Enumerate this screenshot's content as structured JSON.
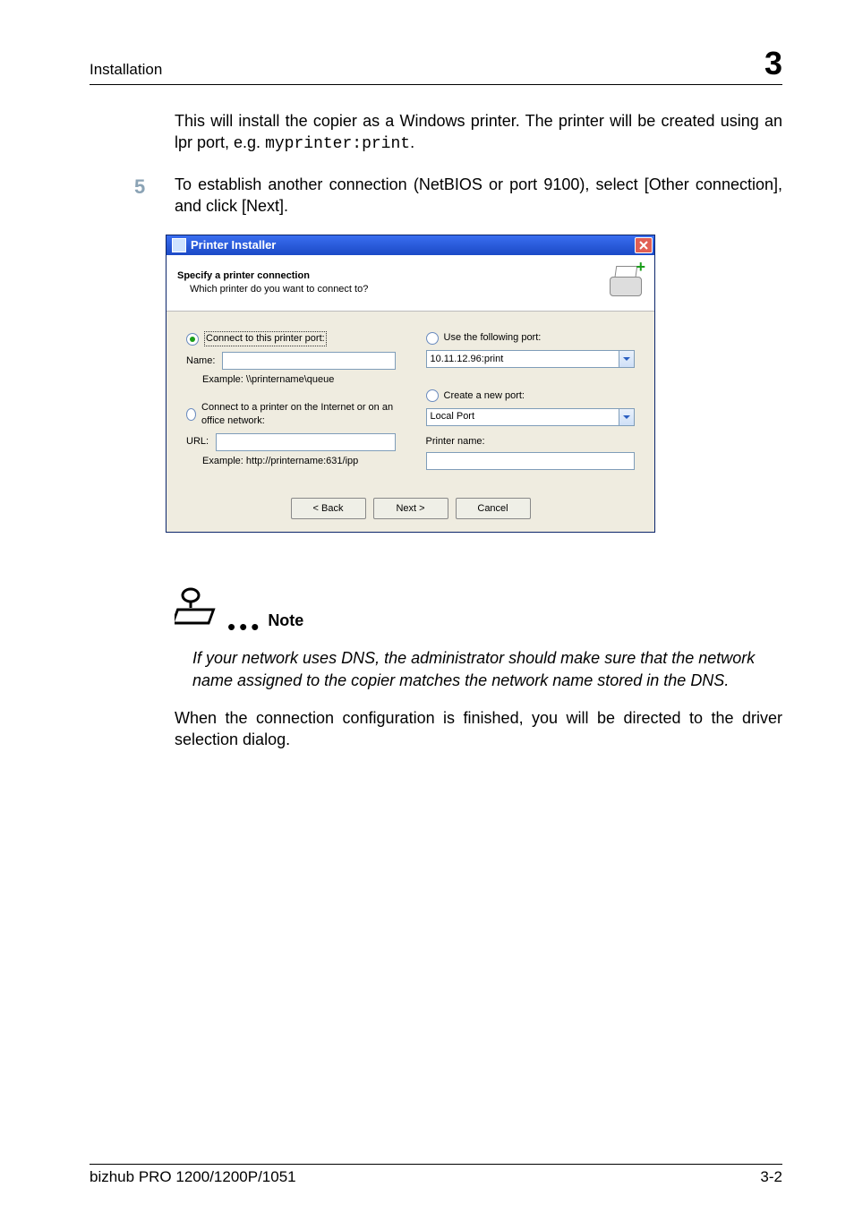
{
  "page": {
    "header_title": "Installation",
    "header_number": "3",
    "footer_left": "bizhub PRO 1200/1200P/1051",
    "footer_right": "3-2"
  },
  "body": {
    "para1_a": "This will install the copier as a Windows printer. The printer will be created using an lpr port, e.g. ",
    "para1_code": "myprinter:print",
    "para1_b": ".",
    "step_number": "5",
    "step_text": "To establish another connection (NetBIOS or port 9100), select [Other connection], and click [Next].",
    "note_label": "Note",
    "note_text": "If your network uses DNS, the administrator should make sure that the network name assigned to the copier matches the network name stored in the DNS.",
    "para2": "When the connection configuration is finished, you will be directed to the driver selection dialog."
  },
  "dialog": {
    "title": "Printer Installer",
    "header_title": "Specify a printer connection",
    "header_sub": "Which printer do you want to connect to?",
    "opt_connect_port": "Connect to this printer port:",
    "name_label": "Name:",
    "name_value": "",
    "name_example": "Example: \\\\printername\\queue",
    "opt_internet": "Connect to a printer on the Internet or on an office network:",
    "url_label": "URL:",
    "url_value": "",
    "url_example": "Example: http://printername:631/ipp",
    "opt_use_port": "Use the following port:",
    "use_port_value": "10.11.12.96:print",
    "opt_create_port": "Create a new port:",
    "create_port_value": "Local Port",
    "printer_name_label": "Printer name:",
    "printer_name_value": "",
    "btn_back": "< Back",
    "btn_next": "Next >",
    "btn_cancel": "Cancel"
  }
}
